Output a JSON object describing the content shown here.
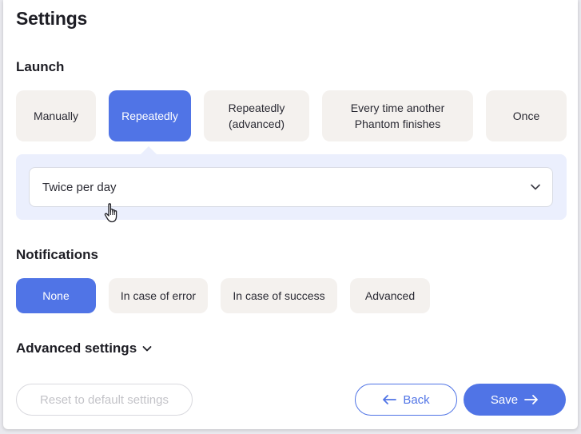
{
  "page": {
    "title": "Settings"
  },
  "launch": {
    "title": "Launch",
    "options": [
      "Manually",
      "Repeatedly",
      "Repeatedly\n(advanced)",
      "Every time another\nPhantom finishes",
      "Once"
    ],
    "selected": "Repeatedly",
    "frequency": {
      "value": "Twice per day"
    }
  },
  "notifications": {
    "title": "Notifications",
    "options": [
      "None",
      "In case of error",
      "In case of success",
      "Advanced"
    ],
    "selected": "None"
  },
  "advanced": {
    "label": "Advanced settings"
  },
  "footer": {
    "reset_label": "Reset to default settings",
    "back_label": "Back",
    "save_label": "Save"
  },
  "colors": {
    "accent": "#5074e6",
    "option_bg": "#f4f1ee",
    "freq_bg": "#ebeffd"
  },
  "icons": {
    "dropdown": "chevron-down-icon",
    "back": "arrow-left-icon",
    "save": "arrow-right-icon",
    "cursor": "hand-pointer-icon"
  }
}
